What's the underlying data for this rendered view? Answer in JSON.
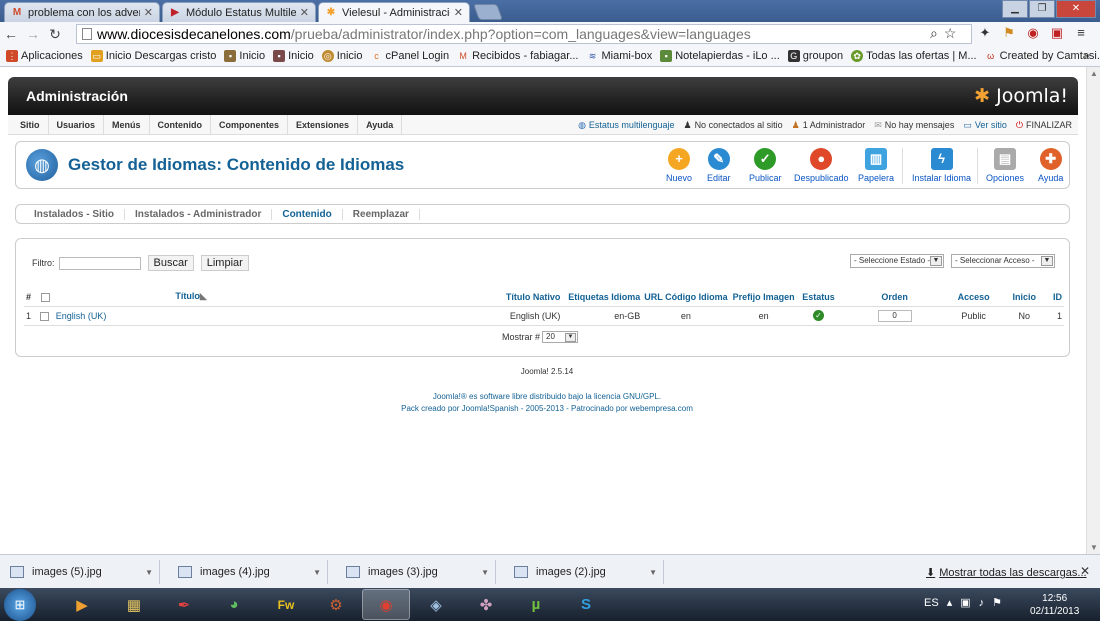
{
  "browser": {
    "tabs": [
      {
        "title": "problema con los advert",
        "icon": "gmail-icon",
        "active": false
      },
      {
        "title": "Módulo Estatus Multileng",
        "icon": "youtube-icon",
        "active": false
      },
      {
        "title": "Vielesul - Administración",
        "icon": "joomla-icon",
        "active": true
      }
    ],
    "url_host": "www.diocesisdecanelones.com",
    "url_path": "/prueba/administrator/index.php?option=com_languages&view=languages",
    "bookmarks": [
      {
        "label": "Aplicaciones",
        "icon": "apps-icon",
        "color": "#d04a2a"
      },
      {
        "label": "Inicio Descargas cristo",
        "icon": "folder-icon",
        "color": "#e0a020"
      },
      {
        "label": "Inicio",
        "icon": "page-icon",
        "color": "#8a6d3b"
      },
      {
        "label": "Inicio",
        "icon": "page-icon",
        "color": "#7a4a4a"
      },
      {
        "label": "Inicio",
        "icon": "globe-icon",
        "color": "#c08a30"
      },
      {
        "label": "cPanel Login",
        "icon": "cpanel-icon",
        "color": "#e07020"
      },
      {
        "label": "Recibidos - fabiagar...",
        "icon": "gmail-icon",
        "color": "#d04a2a"
      },
      {
        "label": "Miami-box",
        "icon": "wave-icon",
        "color": "#3355aa"
      },
      {
        "label": "Notelapierdas - iLo ...",
        "icon": "page-icon",
        "color": "#5a8a3a"
      },
      {
        "label": "groupon",
        "icon": "groupon-icon",
        "color": "#333333"
      },
      {
        "label": "Todas las ofertas | M...",
        "icon": "offer-icon",
        "color": "#6a9a2a"
      },
      {
        "label": "Created by Camtasi...",
        "icon": "camtasia-icon",
        "color": "#c03020"
      }
    ]
  },
  "joomla": {
    "header_title": "Administración",
    "logo_text": "Joomla!",
    "menu": [
      "Sitio",
      "Usuarios",
      "Menús",
      "Contenido",
      "Componentes",
      "Extensiones",
      "Ayuda"
    ],
    "status": [
      {
        "label": "Estatus multilenguaje",
        "link": true
      },
      {
        "label": "No conectados al sitio",
        "link": false
      },
      {
        "label": "1 Administrador",
        "link": false
      },
      {
        "label": "No hay mensajes",
        "link": false
      },
      {
        "label": "Ver sitio",
        "link": true
      },
      {
        "label": "FINALIZAR",
        "link": false
      }
    ],
    "page_title": "Gestor de Idiomas: Contenido de Idiomas",
    "toolbar": [
      {
        "label": "Nuevo",
        "color": "#f5a623",
        "glyph": "+"
      },
      {
        "label": "Editar",
        "color": "#2a8ad2",
        "glyph": "✎"
      },
      {
        "label": "Publicar",
        "color": "#2e9a28",
        "glyph": "✓"
      },
      {
        "label": "Despublicado",
        "color": "#e0482a",
        "glyph": "●"
      },
      {
        "label": "Papelera",
        "color": "#3fa3e0",
        "glyph": "🗑"
      },
      {
        "label": "Instalar Idioma",
        "color": "#2a8ad2",
        "glyph": "⚡"
      },
      {
        "label": "Opciones",
        "color": "#999999",
        "glyph": "▤"
      },
      {
        "label": "Ayuda",
        "color": "#e0622a",
        "glyph": "✚"
      }
    ],
    "subtabs": [
      "Instalados - Sitio",
      "Instalados - Administrador",
      "Contenido",
      "Reemplazar"
    ],
    "current_subtab": "Contenido",
    "filter_label": "Filtro:",
    "filter_value": "",
    "search_button": "Buscar",
    "clear_button": "Limpiar",
    "state_select": "- Seleccione Estado -",
    "access_select": "- Seleccionar Acceso -",
    "columns": [
      "#",
      "Título",
      "Título Nativo",
      "Etiquetas Idioma",
      "URL Código Idioma",
      "Prefijo Imagen",
      "Estatus",
      "Orden",
      "Acceso",
      "Inicio",
      "ID"
    ],
    "rows": [
      {
        "num": "1",
        "title": "English (UK)",
        "native": "English (UK)",
        "tag": "en-GB",
        "url_code": "en",
        "prefix": "en",
        "status": "published",
        "order": "0",
        "access": "Public",
        "home": "No",
        "id": "1"
      }
    ],
    "show_label": "Mostrar #",
    "show_value": "20",
    "version": "Joomla! 2.5.14",
    "footer_line1": "Joomla!® es software libre distribuido bajo la licencia GNU/GPL.",
    "footer_line2_prefix": "Pack creado por Joomla!Spanish - 2005-2013 - Patrocinado por ",
    "footer_line2_link": "webempresa.com"
  },
  "downloads": {
    "items": [
      "images (5).jpg",
      "images (4).jpg",
      "images (3).jpg",
      "images (2).jpg"
    ],
    "show_all": "Mostrar todas las descargas..."
  },
  "taskbar": {
    "language": "ES",
    "time": "12:56",
    "date": "02/11/2013"
  }
}
